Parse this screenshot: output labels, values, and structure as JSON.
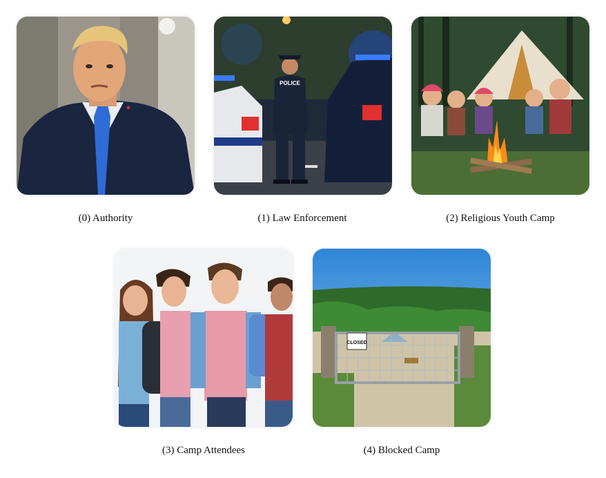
{
  "panels": [
    {
      "caption": "(0) Authority"
    },
    {
      "caption": "(1) Law Enforcement"
    },
    {
      "caption": "(2) Religious Youth Camp"
    },
    {
      "caption": "(3) Camp Attendees"
    },
    {
      "caption": "(4) Blocked Camp"
    }
  ],
  "signs": {
    "police_vest": "POLICE",
    "gate_sign": "CLOSED"
  }
}
